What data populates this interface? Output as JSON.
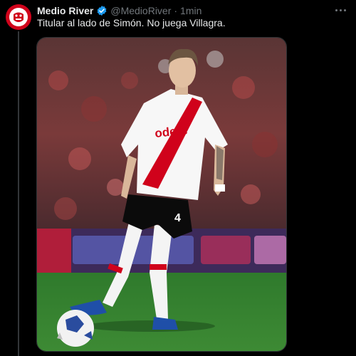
{
  "tweet": {
    "author_name": "Medio River",
    "handle": "@MedioRiver",
    "separator": "·",
    "time": "1min",
    "text": "Titular al lado de Simón. No juega Villagra.",
    "jersey_sponsor": "odere",
    "shorts_number": "4"
  },
  "icons": {
    "verified": "verified-badge-icon",
    "more": "more-dots-icon",
    "avatar": "club-logo-avatar"
  },
  "colors": {
    "background": "#000000",
    "text": "#e7e9ea",
    "muted": "#71767b",
    "verified": "#1d9bf0",
    "brand_red": "#d0021b"
  }
}
